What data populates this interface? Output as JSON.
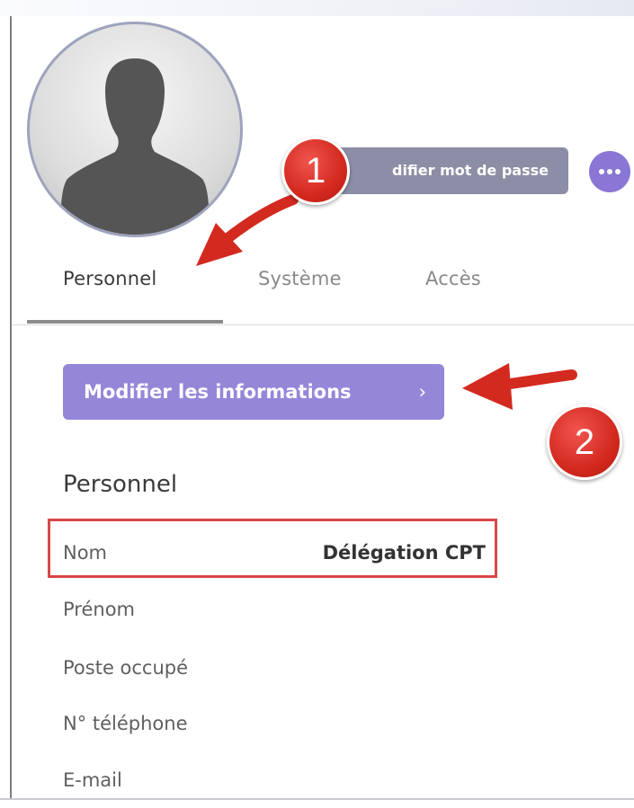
{
  "header": {
    "change_password_label": "difier mot de passe",
    "more_label": "•••"
  },
  "callouts": {
    "badge_1": "1",
    "badge_2": "2"
  },
  "tabs": [
    {
      "label": "Personnel",
      "active": true
    },
    {
      "label": "Système",
      "active": false
    },
    {
      "label": "Accès",
      "active": false
    }
  ],
  "edit_button": {
    "label": "Modifier les informations",
    "chevron": "›"
  },
  "section": {
    "title": "Personnel",
    "fields": [
      {
        "label": "Nom",
        "value": "Délégation CPT"
      },
      {
        "label": "Prénom",
        "value": ""
      },
      {
        "label": "Poste occupé",
        "value": ""
      },
      {
        "label": "N° téléphone",
        "value": ""
      },
      {
        "label": "E-mail",
        "value": ""
      }
    ]
  },
  "colors": {
    "accent": "#9686d8",
    "more_button": "#8a76d4",
    "password_button": "#8c8ea6",
    "callout_red": "#d3291f",
    "highlight_red": "#d9474a"
  }
}
